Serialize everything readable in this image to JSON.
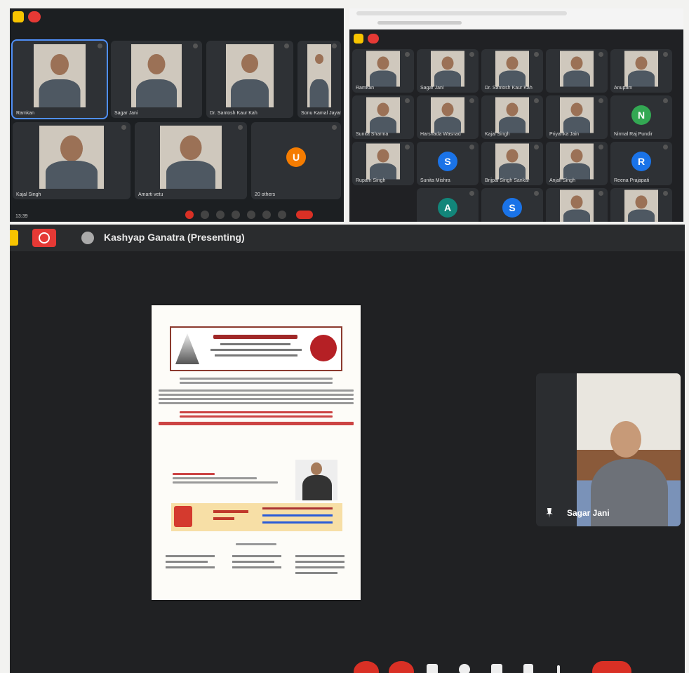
{
  "top_left": {
    "tiles": [
      {
        "name": "Ramkan",
        "type": "photo"
      },
      {
        "name": "Sagar Jani",
        "type": "photo"
      },
      {
        "name": "Dr. Santosh Kaur Kah",
        "type": "photo"
      },
      {
        "name": "Sonu Kamal Jayamu",
        "type": "photo"
      },
      {
        "name": "Kajal Singh",
        "type": "photo"
      },
      {
        "name": "Amarti vetu",
        "type": "photo"
      },
      {
        "name": "20 others",
        "type": "others",
        "letter": "U"
      }
    ],
    "time": "13:39"
  },
  "top_right": {
    "tiles": [
      {
        "name": "Ramkan",
        "type": "photo"
      },
      {
        "name": "Sagar Jani",
        "type": "photo"
      },
      {
        "name": "Dr. Santosh Kaur Kah",
        "type": "photo"
      },
      {
        "name": "",
        "type": "photo"
      },
      {
        "name": "Anupam",
        "type": "photo"
      },
      {
        "name": "Sunita Sharma",
        "type": "photo"
      },
      {
        "name": "Harshada Wasnad",
        "type": "photo"
      },
      {
        "name": "Kajal Singh",
        "type": "photo"
      },
      {
        "name": "Priyanka Jain",
        "type": "photo"
      },
      {
        "name": "Nirmal Raj Pundir",
        "type": "letter",
        "letter": "N",
        "color": "#33a853"
      },
      {
        "name": "Rupam Singh",
        "type": "photo"
      },
      {
        "name": "Sunita Mishra",
        "type": "letter",
        "letter": "S",
        "color": "#1a73e8"
      },
      {
        "name": "Brijpal Singh Sankar",
        "type": "photo"
      },
      {
        "name": "Anjali Singh",
        "type": "photo"
      },
      {
        "name": "Reena Prajapati",
        "type": "letter",
        "letter": "R",
        "color": "#1a73e8"
      },
      {
        "name": "",
        "type": "letter",
        "letter": "A",
        "color": "#12867a"
      },
      {
        "name": "",
        "type": "letter",
        "letter": "S",
        "color": "#1a73e8"
      },
      {
        "name": "",
        "type": "photo"
      },
      {
        "name": "",
        "type": "photo"
      }
    ]
  },
  "presentation": {
    "presenter_label": "Kashyap Ganatra (Presenting)",
    "speaker_name": "Sagar Jani"
  },
  "colors": {
    "end_call": "#d93025",
    "tile_bg": "#2e3135",
    "meet_bg": "#1c1f22"
  },
  "icons": [
    "meet-logo-icon",
    "record-icon",
    "presenting-icon",
    "pin-icon",
    "mic-icon",
    "camera-icon",
    "present-icon",
    "hand-icon",
    "end-call-icon"
  ]
}
